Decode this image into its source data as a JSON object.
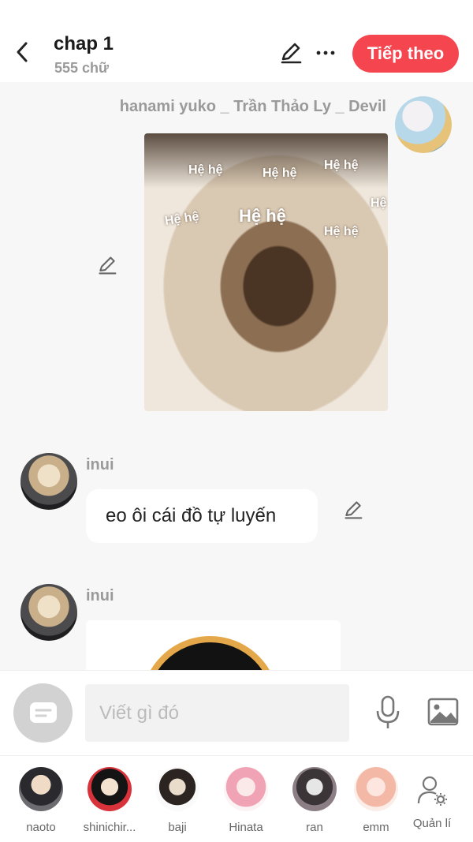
{
  "header": {
    "title": "chap 1",
    "word_count": "555 chữ",
    "next_label": "Tiếp theo",
    "accent_color": "#f5454f"
  },
  "messages": [
    {
      "sender": "hanami yuko _ Trần Thảo Ly _ Devil",
      "side": "right",
      "type": "image",
      "image_caption_words": [
        "Hệ hệ",
        "Hệ hệ",
        "Hệ hệ",
        "Hệ hệ",
        "Hệ hệ",
        "Hệ hệ",
        "Hệ"
      ]
    },
    {
      "sender": "inui",
      "side": "left",
      "type": "text",
      "text": "eo ôi cái đồ tự luyến"
    },
    {
      "sender": "inui",
      "side": "left",
      "type": "image"
    }
  ],
  "input": {
    "placeholder": "Viết gì đó"
  },
  "characters": [
    {
      "name": "naoto"
    },
    {
      "name": "shinichir..."
    },
    {
      "name": "baji"
    },
    {
      "name": "Hinata"
    },
    {
      "name": "ran"
    },
    {
      "name": "emm"
    }
  ],
  "manage_label": "Quản lí",
  "icons": [
    "back-icon",
    "edit-icon",
    "more-icon",
    "pencil-icon",
    "chat-bubble-icon",
    "microphone-icon",
    "image-icon",
    "user-settings-icon"
  ]
}
